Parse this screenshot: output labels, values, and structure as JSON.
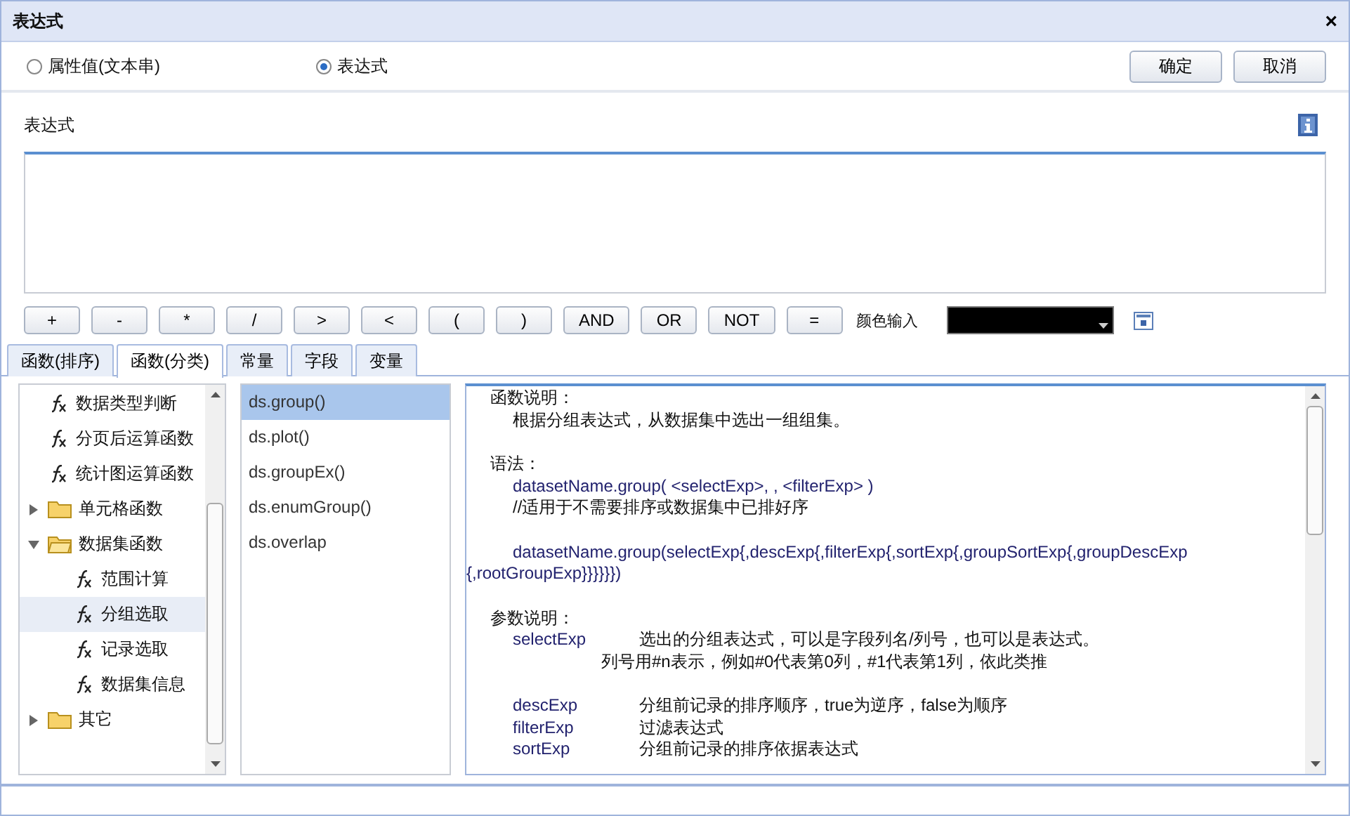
{
  "window": {
    "title": "表达式",
    "close": "×"
  },
  "value_type": [
    {
      "label": "属性值(文本串)",
      "selected": false
    },
    {
      "label": "表达式",
      "selected": true
    }
  ],
  "buttons": [
    "确定",
    "取消"
  ],
  "expression": {
    "label": "表达式"
  },
  "operators": [
    "+",
    "-",
    "*",
    "/",
    ">",
    "<",
    "(",
    ")",
    "AND",
    "OR",
    "NOT",
    "="
  ],
  "color_input": {
    "label": "颜色输入",
    "color": "#000000"
  },
  "tabs": [
    {
      "label": "函数(排序)",
      "selected": false
    },
    {
      "label": "函数(分类)",
      "selected": true
    },
    {
      "label": "常量",
      "selected": false
    },
    {
      "label": "字段",
      "selected": false
    },
    {
      "label": "变量",
      "selected": false
    }
  ],
  "tree": [
    {
      "kind": "function",
      "label": "数据类型判断",
      "selected": false
    },
    {
      "kind": "function",
      "label": "分页后运算函数",
      "selected": false
    },
    {
      "kind": "function",
      "label": "统计图运算函数",
      "selected": false
    },
    {
      "kind": "folder",
      "label": "单元格函数",
      "expanded": false
    },
    {
      "kind": "folder",
      "label": "数据集函数",
      "expanded": true,
      "children": [
        {
          "kind": "function",
          "label": "范围计算",
          "selected": false
        },
        {
          "kind": "function",
          "label": "分组选取",
          "selected": true
        },
        {
          "kind": "function",
          "label": "记录选取",
          "selected": false
        },
        {
          "kind": "function",
          "label": "数据集信息",
          "selected": false
        }
      ]
    },
    {
      "kind": "folder",
      "label": "其它",
      "expanded": false
    }
  ],
  "functions": [
    {
      "label": "ds.group()",
      "selected": true
    },
    {
      "label": "ds.plot()",
      "selected": false
    },
    {
      "label": "ds.groupEx()",
      "selected": false
    },
    {
      "label": "ds.enumGroup()",
      "selected": false
    },
    {
      "label": "ds.overlap",
      "selected": false
    }
  ],
  "doc": [
    {
      "heading": "函数说明：",
      "lines": [
        {
          "kind": "text",
          "text": "根据分组表达式，从数据集中选出一组组集。"
        }
      ]
    },
    {
      "heading": "语法：",
      "lines": [
        {
          "kind": "code",
          "text": "datasetName.group( <selectExp>, , <filterExp> )"
        },
        {
          "kind": "text",
          "text": "//适用于不需要排序或数据集中已排好序"
        },
        {
          "kind": "wrap",
          "text": "datasetName.group(selectExp{,descExp{,filterExp{,sortExp{,groupSortExp{,groupDescExp {,rootGroupExp}}}}}})"
        }
      ]
    },
    {
      "heading": "参数说明：",
      "params": [
        {
          "name": "selectExp",
          "desc": "选出的分组表达式，可以是字段列名/列号，也可以是表达式。",
          "more": "列号用#n表示，例如#0代表第0列，#1代表第1列，依此类推"
        },
        {
          "name": "descExp",
          "desc": "分组前记录的排序顺序，true为逆序，false为顺序"
        },
        {
          "name": "filterExp",
          "desc": "过滤表达式"
        },
        {
          "name": "sortExp",
          "desc": "分组前记录的排序依据表达式"
        }
      ]
    }
  ]
}
